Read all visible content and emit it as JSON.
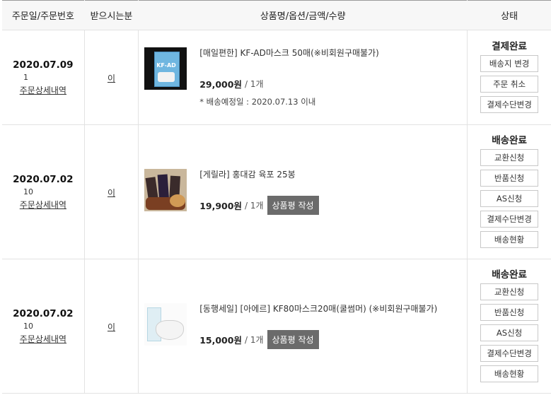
{
  "headers": {
    "order": "주문일/주문번호",
    "receiver": "받으시는분",
    "product": "상품명/옵션/금액/수량",
    "status": "상태"
  },
  "orders": [
    {
      "date": "2020.07.09",
      "number": "1",
      "detail_link": "주문상세내역",
      "receiver": "이",
      "product_name": "[매일편한] KF-AD마스크 50매(※비회원구매불가)",
      "price": "29,000원",
      "qty": "/ 1개",
      "ship_note": "* 배송예정일 : 2020.07.13 이내",
      "review_button": "",
      "status": "결제완료",
      "actions": [
        "배송지 변경",
        "주문 취소",
        "결제수단변경"
      ]
    },
    {
      "date": "2020.07.02",
      "number": "10",
      "detail_link": "주문상세내역",
      "receiver": "이",
      "product_name": "[게릴라] 홍대감 육포 25봉",
      "price": "19,900원",
      "qty": "/ 1개",
      "ship_note": "",
      "review_button": "상품평 작성",
      "status": "배송완료",
      "actions": [
        "교환신청",
        "반품신청",
        "AS신청",
        "결제수단변경",
        "배송현황"
      ]
    },
    {
      "date": "2020.07.02",
      "number": "10",
      "detail_link": "주문상세내역",
      "receiver": "이",
      "product_name": "[동행세일] [아에르] KF80마스크20매(쿨썸머) (※비회원구매불가)",
      "price": "15,000원",
      "qty": "/ 1개",
      "ship_note": "",
      "review_button": "상품평 작성",
      "status": "배송완료",
      "actions": [
        "교환신청",
        "반품신청",
        "AS신청",
        "결제수단변경",
        "배송현황"
      ]
    }
  ],
  "thumb0_label": "KF-AD"
}
